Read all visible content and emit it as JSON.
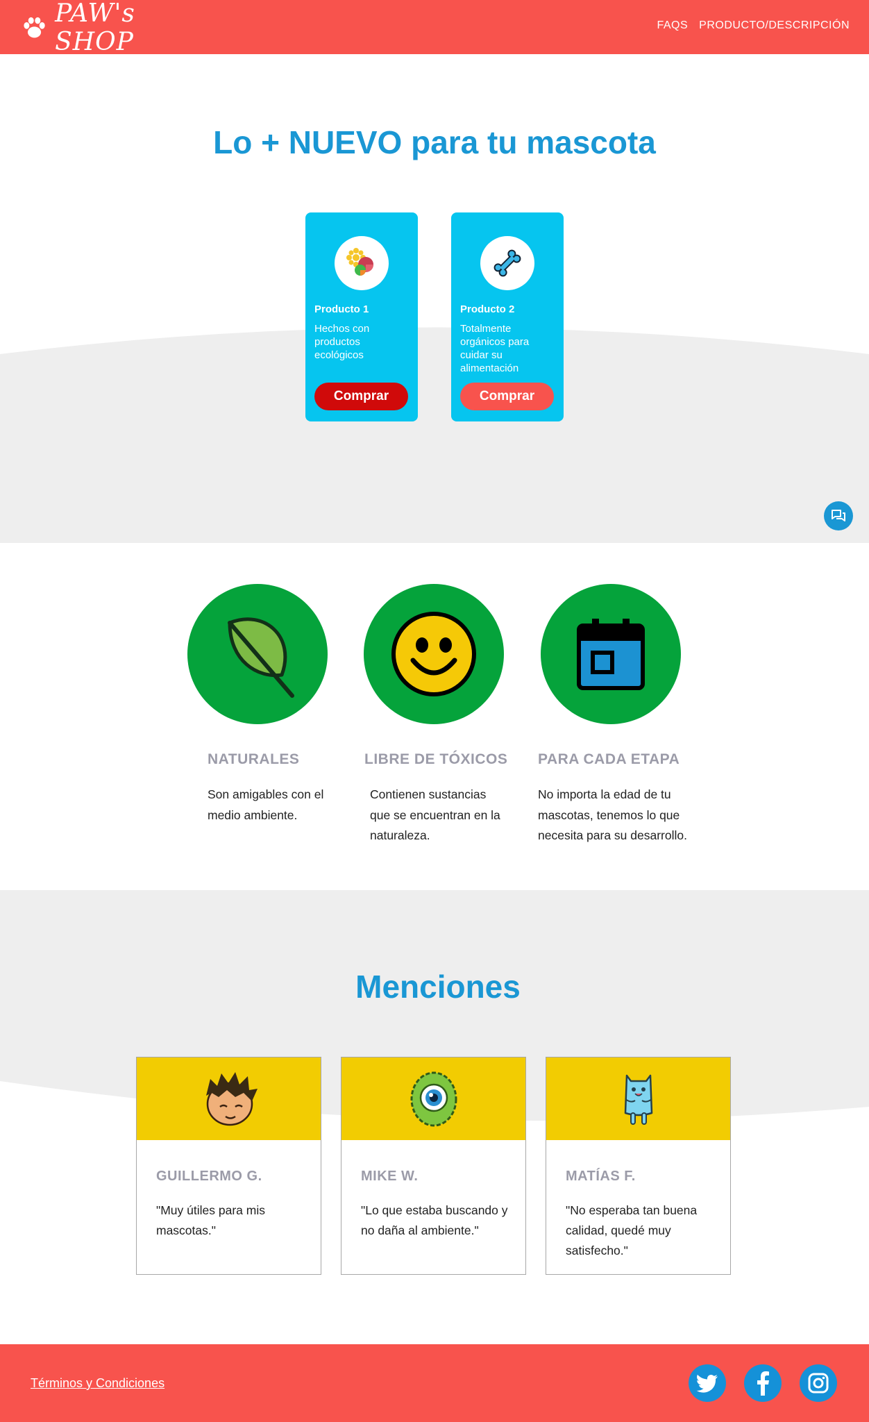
{
  "header": {
    "brand": "PAW's SHOP",
    "nav": [
      "FAQS",
      "PRODUCTO/DESCRIPCIÓN"
    ]
  },
  "hero": {
    "title": "Lo + NUEVO para tu mascota",
    "products": [
      {
        "name": "Producto 1",
        "desc": "Hechos con productos ecológicos",
        "button": "Comprar",
        "button_color": "#d00a0a"
      },
      {
        "name": "Producto 2",
        "desc": "Totalmente orgánicos para cuidar su alimentación",
        "button": "Comprar",
        "button_color": "#f8534d"
      }
    ]
  },
  "features": [
    {
      "title": "NATURALES",
      "desc": "Son amigables con el medio ambiente.",
      "icon": "leaf-icon"
    },
    {
      "title": "LIBRE DE TÓXICOS",
      "desc": "Contienen sustancias que se encuentran en la naturaleza.",
      "icon": "smiley-icon"
    },
    {
      "title": "PARA CADA ETAPA",
      "desc": "No importa la edad de tu mascotas, tenemos lo que necesita para su desarrollo.",
      "icon": "calendar-icon"
    }
  ],
  "mentions": {
    "title": "Menciones",
    "items": [
      {
        "name": "GUILLERMO G.",
        "quote": "\"Muy útiles para mis mascotas.\""
      },
      {
        "name": "MIKE W.",
        "quote": "\"Lo que estaba buscando y no daña al ambiente.\""
      },
      {
        "name": "MATÍAS F.",
        "quote": "\"No esperaba tan buena calidad, quedé muy satisfecho.\""
      }
    ]
  },
  "footer": {
    "terms": "Términos y Condiciones",
    "social": [
      "twitter-icon",
      "facebook-icon",
      "instagram-icon"
    ]
  },
  "colors": {
    "brand_red": "#f8534d",
    "accent_blue": "#1a97d4",
    "card_cyan": "#06c5ef",
    "feature_green": "#05a33b",
    "mention_yellow": "#f2cc02",
    "section_gray": "#eeeeee"
  }
}
